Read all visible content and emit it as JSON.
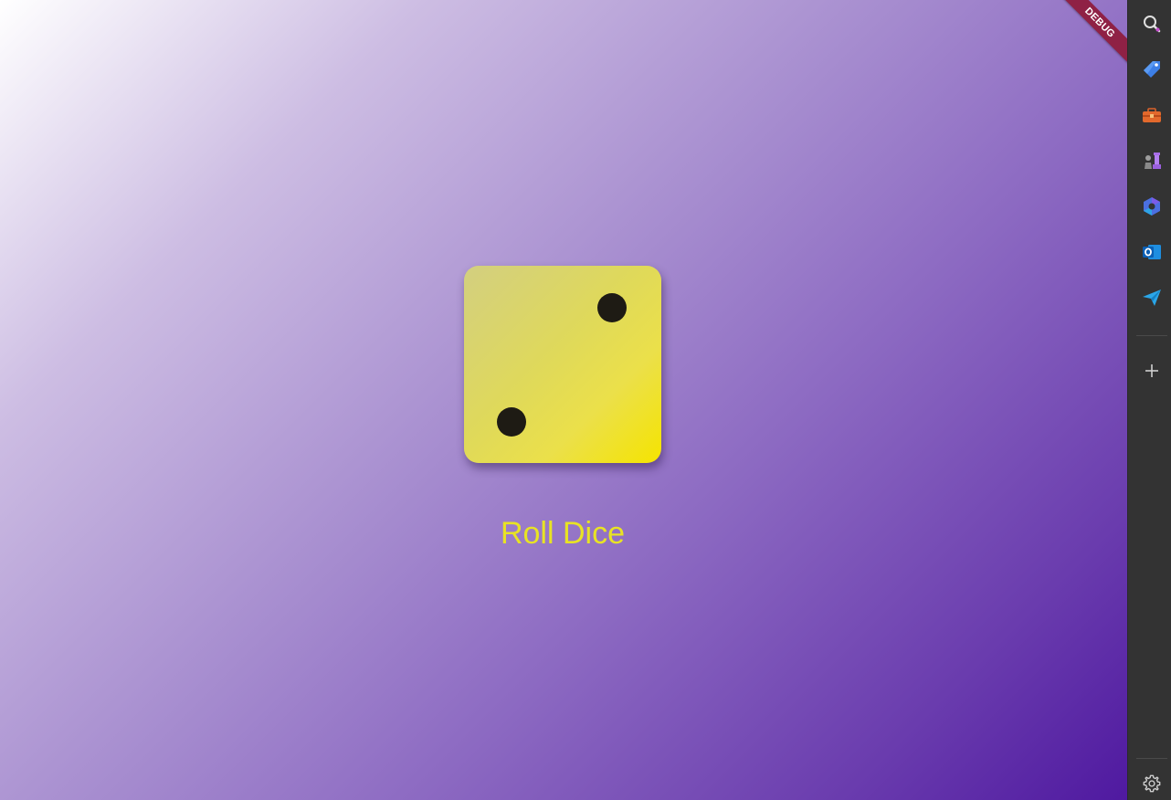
{
  "app": {
    "debug_banner": "DEBUG",
    "dice": {
      "value": 2
    },
    "roll_button_label": "Roll Dice",
    "colors": {
      "gradient_start": "#ffffff",
      "gradient_end": "#4f19a0",
      "dice_face": "#e8e050",
      "pip": "#1e1b14",
      "button_text": "#e8e324",
      "debug_ribbon": "#8f2145"
    }
  },
  "sidebar": {
    "items": [
      {
        "icon": "search-icon"
      },
      {
        "icon": "tag-icon"
      },
      {
        "icon": "toolbox-icon"
      },
      {
        "icon": "chess-icon"
      },
      {
        "icon": "copilot-icon"
      },
      {
        "icon": "outlook-icon"
      },
      {
        "icon": "send-icon"
      },
      {
        "icon": "add-icon"
      },
      {
        "icon": "gear-icon"
      }
    ]
  }
}
